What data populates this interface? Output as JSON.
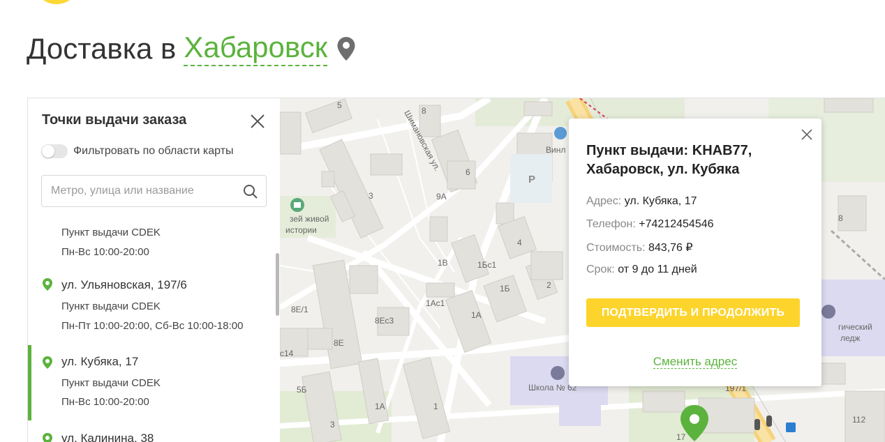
{
  "header": {
    "title_prefix": "Доставка в",
    "city": "Хабаровск",
    "location_icon": "map-pin-icon"
  },
  "sidebar": {
    "title": "Точки выдачи заказа",
    "close_icon": "close-icon",
    "filter_label": "Фильтровать по области карты",
    "filter_on": false,
    "search_placeholder": "Метро, улица или название",
    "search_icon": "search-icon",
    "points": [
      {
        "address": "",
        "type": "Пункт выдачи CDEK",
        "hours": "Пн-Вс 10:00-20:00",
        "selected": false
      },
      {
        "address": "ул. Ульяновская, 197/6",
        "type": "Пункт выдачи CDEK",
        "hours": "Пн-Пт 10:00-20:00, Сб-Вс 10:00-18:00",
        "selected": false
      },
      {
        "address": "ул. Кубяка, 17",
        "type": "Пункт выдачи CDEK",
        "hours": "Пн-Вс 10:00-20:00",
        "selected": true
      },
      {
        "address": "ул. Калинина, 38",
        "type": "",
        "hours": "",
        "selected": false
      }
    ]
  },
  "popup": {
    "title": "Пункт выдачи: KHAB77, Хабаровск, ул. Кубяка",
    "address_label": "Адрес:",
    "address": "ул. Кубяка, 17",
    "phone_label": "Телефон:",
    "phone": "+74212454546",
    "cost_label": "Стоимость:",
    "cost": "843,76 ₽",
    "term_label": "Срок:",
    "term": "от 9 до 11 дней",
    "confirm_button": "ПОДТВЕРДИТЬ И ПРОДОЛЖИТЬ",
    "change_address_link": "Сменить адрес"
  },
  "map": {
    "street_label": "Шимановская ул.",
    "poi_museum": "Музей живой истории",
    "poi_museum_line1": "зей живой",
    "poi_museum_line2": "истории",
    "poi_school": "Школа № 62",
    "poi_shop": "Винл",
    "poi_college_line1": "гический",
    "poi_college_line2": "ледж",
    "parking_label": "P",
    "building_numbers": [
      "5",
      "8",
      "6",
      "3",
      "9А",
      "4",
      "1Бс1",
      "1В",
      "2",
      "1Б",
      "8Е/1",
      "1Ас1",
      "1А",
      "8Ес3",
      "8Е",
      "с14",
      "5Б",
      "3",
      "1А",
      "1",
      "17",
      "112",
      "8",
      "197/1"
    ],
    "colors": {
      "accent": "#5bb33d",
      "button": "#fdd42b"
    }
  }
}
